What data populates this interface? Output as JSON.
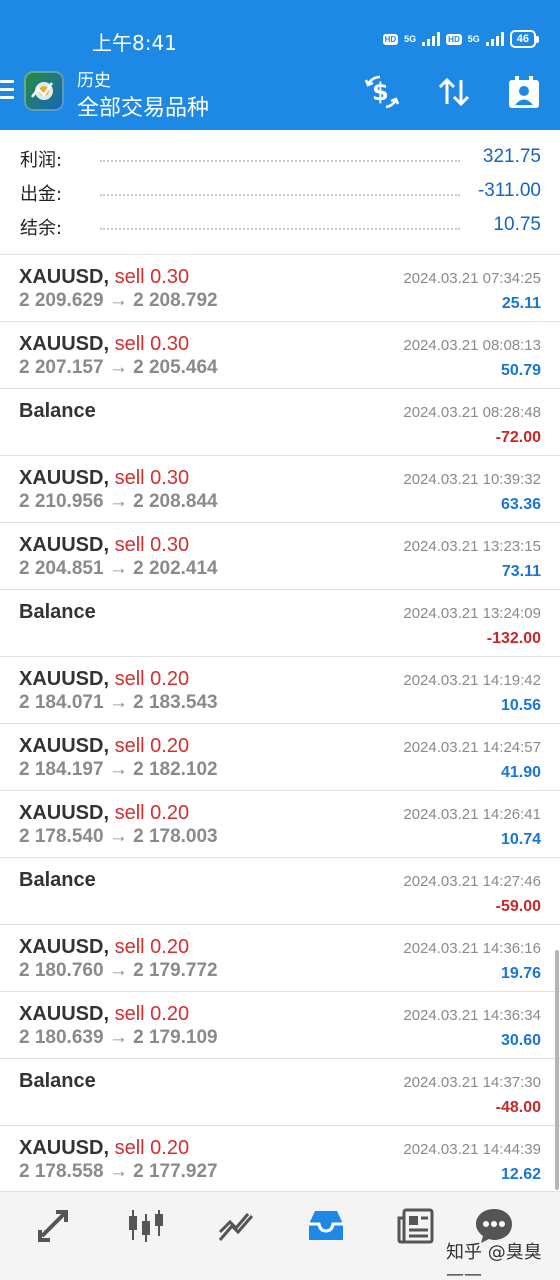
{
  "status_bar": {
    "time": "上午8:41",
    "hd1": "HD",
    "net1": "5G",
    "hd2": "HD",
    "net2": "5G",
    "battery": "46"
  },
  "header": {
    "subtitle": "历史",
    "title": "全部交易品种"
  },
  "summary": [
    {
      "label": "利润:",
      "value": "321.75"
    },
    {
      "label": "出金:",
      "value": "-311.00"
    },
    {
      "label": "结余:",
      "value": "10.75"
    }
  ],
  "deals": [
    {
      "type": "trade",
      "symbol": "XAUUSD",
      "comma": ",",
      "side": "sell 0.30",
      "open": "2 209.629",
      "arrow": "→",
      "close": "2 208.792",
      "datetime": "2024.03.21 07:34:25",
      "profit": "25.11",
      "sign": "pos"
    },
    {
      "type": "trade",
      "symbol": "XAUUSD",
      "comma": ",",
      "side": "sell 0.30",
      "open": "2 207.157",
      "arrow": "→",
      "close": "2 205.464",
      "datetime": "2024.03.21 08:08:13",
      "profit": "50.79",
      "sign": "pos"
    },
    {
      "type": "balance",
      "symbol": "Balance",
      "datetime": "2024.03.21 08:28:48",
      "profit": "-72.00",
      "sign": "neg"
    },
    {
      "type": "trade",
      "symbol": "XAUUSD",
      "comma": ",",
      "side": "sell 0.30",
      "open": "2 210.956",
      "arrow": "→",
      "close": "2 208.844",
      "datetime": "2024.03.21 10:39:32",
      "profit": "63.36",
      "sign": "pos"
    },
    {
      "type": "trade",
      "symbol": "XAUUSD",
      "comma": ",",
      "side": "sell 0.30",
      "open": "2 204.851",
      "arrow": "→",
      "close": "2 202.414",
      "datetime": "2024.03.21 13:23:15",
      "profit": "73.11",
      "sign": "pos"
    },
    {
      "type": "balance",
      "symbol": "Balance",
      "datetime": "2024.03.21 13:24:09",
      "profit": "-132.00",
      "sign": "neg"
    },
    {
      "type": "trade",
      "symbol": "XAUUSD",
      "comma": ",",
      "side": "sell 0.20",
      "open": "2 184.071",
      "arrow": "→",
      "close": "2 183.543",
      "datetime": "2024.03.21 14:19:42",
      "profit": "10.56",
      "sign": "pos"
    },
    {
      "type": "trade",
      "symbol": "XAUUSD",
      "comma": ",",
      "side": "sell 0.20",
      "open": "2 184.197",
      "arrow": "→",
      "close": "2 182.102",
      "datetime": "2024.03.21 14:24:57",
      "profit": "41.90",
      "sign": "pos"
    },
    {
      "type": "trade",
      "symbol": "XAUUSD",
      "comma": ",",
      "side": "sell 0.20",
      "open": "2 178.540",
      "arrow": "→",
      "close": "2 178.003",
      "datetime": "2024.03.21 14:26:41",
      "profit": "10.74",
      "sign": "pos"
    },
    {
      "type": "balance",
      "symbol": "Balance",
      "datetime": "2024.03.21 14:27:46",
      "profit": "-59.00",
      "sign": "neg"
    },
    {
      "type": "trade",
      "symbol": "XAUUSD",
      "comma": ",",
      "side": "sell 0.20",
      "open": "2 180.760",
      "arrow": "→",
      "close": "2 179.772",
      "datetime": "2024.03.21 14:36:16",
      "profit": "19.76",
      "sign": "pos"
    },
    {
      "type": "trade",
      "symbol": "XAUUSD",
      "comma": ",",
      "side": "sell 0.20",
      "open": "2 180.639",
      "arrow": "→",
      "close": "2 179.109",
      "datetime": "2024.03.21 14:36:34",
      "profit": "30.60",
      "sign": "pos"
    },
    {
      "type": "balance",
      "symbol": "Balance",
      "datetime": "2024.03.21 14:37:30",
      "profit": "-48.00",
      "sign": "neg"
    },
    {
      "type": "trade",
      "symbol": "XAUUSD",
      "comma": ",",
      "side": "sell 0.20",
      "open": "2 178.558",
      "arrow": "→",
      "close": "2 177.927",
      "datetime": "2024.03.21 14:44:39",
      "profit": "12.62",
      "sign": "pos"
    }
  ],
  "bottom_nav": {
    "items": [
      "quotes-icon",
      "chart-icon",
      "trade-icon",
      "history-icon",
      "news-icon",
      "chat-icon"
    ],
    "active": "history-icon"
  },
  "watermark": "知乎 @臭臭——",
  "colors": {
    "header": "#1e88e5",
    "profit_pos": "#1976d2",
    "profit_neg": "#c62828",
    "sell": "#d32f2f"
  }
}
